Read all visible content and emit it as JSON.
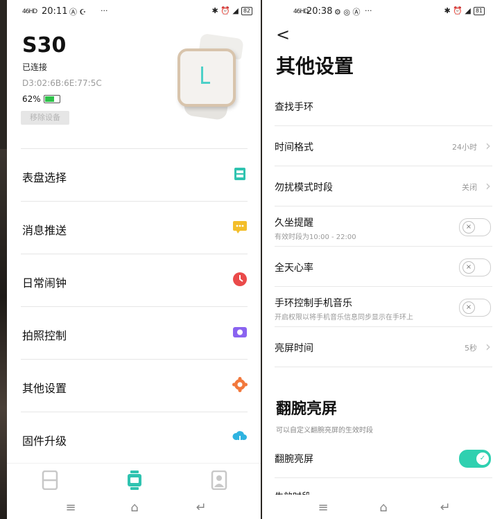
{
  "left": {
    "status": {
      "signal": "46HD",
      "time": "20:11",
      "icons": "Ⓐ ☪",
      "more": "···",
      "right_icons": "✱ ⏰ ◢",
      "battery": "82"
    },
    "device": {
      "name": "S30",
      "status": "已连接",
      "mac": "D3:02:6B:6E:77:5C",
      "battery_pct": "62%",
      "battery_level": 0.62,
      "remove_label": "移除设备"
    },
    "menu": [
      {
        "label": "表盘选择",
        "icon": "watchface-icon",
        "color": "#2fc3b0"
      },
      {
        "label": "消息推送",
        "icon": "message-icon",
        "color": "#f3be2a"
      },
      {
        "label": "日常闹钟",
        "icon": "clock-icon",
        "color": "#ea4a4a"
      },
      {
        "label": "拍照控制",
        "icon": "camera-icon",
        "color": "#8a63f0"
      },
      {
        "label": "其他设置",
        "icon": "gear-icon",
        "color": "#f2783c"
      },
      {
        "label": "固件升级",
        "icon": "cloud-download-icon",
        "color": "#2fb3e0"
      }
    ],
    "tabs": [
      {
        "icon": "device-tab-icon",
        "active": false
      },
      {
        "icon": "watch-tab-icon",
        "active": true,
        "color": "#2fc3b0"
      },
      {
        "icon": "profile-tab-icon",
        "active": false
      }
    ]
  },
  "right": {
    "status": {
      "signal": "46HD",
      "time": "20:38",
      "icons": "⚙ ◎ Ⓐ",
      "more": "···",
      "right_icons": "✱ ⏰ ◢",
      "battery": "81"
    },
    "back": "<",
    "title": "其他设置",
    "rows": [
      {
        "label": "查找手环",
        "type": "plain"
      },
      {
        "label": "时间格式",
        "type": "value",
        "value": "24小时"
      },
      {
        "label": "勿扰模式时段",
        "type": "value",
        "value": "关闭"
      },
      {
        "label": "久坐提醒",
        "type": "toggle",
        "on": false,
        "sub": "有效时段为10:00 - 22:00"
      },
      {
        "label": "全天心率",
        "type": "toggle",
        "on": false
      },
      {
        "label": "手环控制手机音乐",
        "type": "toggle",
        "on": false,
        "sub": "开启权限以将手机音乐信息同步显示在手环上"
      },
      {
        "label": "亮屏时间",
        "type": "value",
        "value": "5秒"
      }
    ],
    "section_title": "翻腕亮屏",
    "section_desc": "可以自定义翻腕亮屏的生效时段",
    "flip_row": {
      "label": "翻腕亮屏",
      "on": true
    },
    "partial_row": "生效时段"
  },
  "nav": {
    "menu": "≡",
    "home": "⌂",
    "back": "↵"
  }
}
